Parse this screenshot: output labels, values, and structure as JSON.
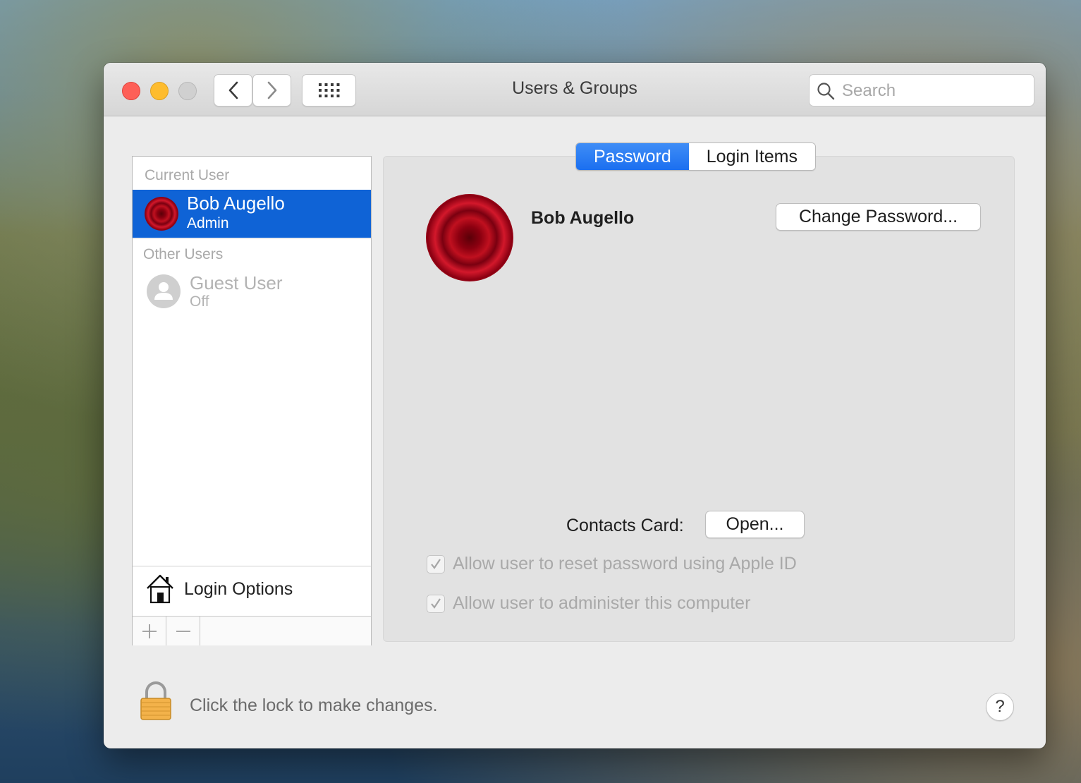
{
  "window": {
    "title": "Users & Groups"
  },
  "toolbar": {
    "search_placeholder": "Search"
  },
  "sidebar": {
    "current_user_header": "Current User",
    "current_user": {
      "name": "Bob Augello",
      "role": "Admin"
    },
    "other_users_header": "Other Users",
    "other_users": [
      {
        "name": "Guest User",
        "status": "Off"
      }
    ],
    "login_options_label": "Login Options"
  },
  "tabs": [
    {
      "label": "Password",
      "active": true
    },
    {
      "label": "Login Items",
      "active": false
    }
  ],
  "main": {
    "user_name": "Bob Augello",
    "change_password_label": "Change Password...",
    "contacts_card_label": "Contacts Card:",
    "open_button_label": "Open...",
    "checkboxes": [
      {
        "label": "Allow user to reset password using Apple ID",
        "checked": true,
        "enabled": false
      },
      {
        "label": "Allow user to administer this computer",
        "checked": true,
        "enabled": false
      }
    ]
  },
  "footer": {
    "lock_text": "Click the lock to make changes.",
    "help_label": "?"
  },
  "icons": {
    "back": "chevron-left-icon",
    "forward": "chevron-right-icon",
    "grid": "grid-icon",
    "search": "search-icon",
    "house": "house-icon",
    "add": "plus-icon",
    "remove": "minus-icon",
    "lock": "lock-icon",
    "guest_avatar": "person-icon"
  },
  "colors": {
    "selection": "#0f63d6",
    "tab_active": "#1b6ff0",
    "close": "#fe5f57",
    "minimize": "#febc2e"
  }
}
